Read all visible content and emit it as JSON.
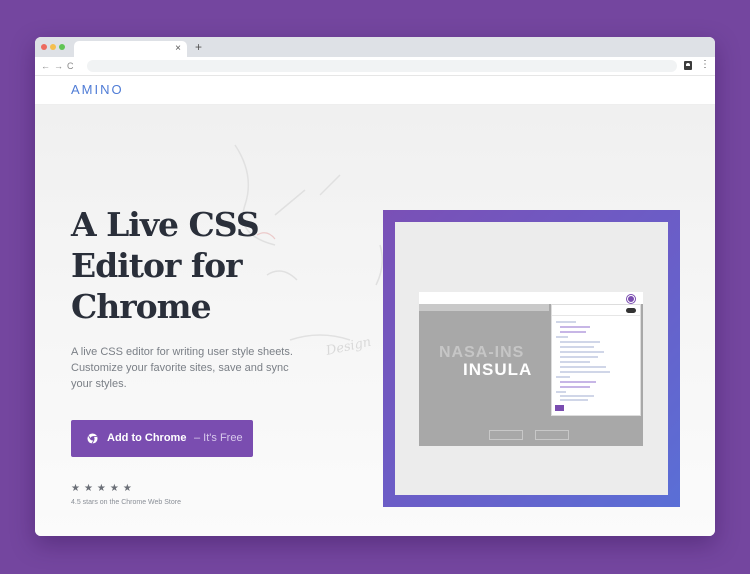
{
  "browser": {
    "tab_close": "×",
    "new_tab": "+",
    "nav": {
      "back": "←",
      "forward": "→",
      "reload": "C"
    },
    "menu": "⋮",
    "icons": [
      "close-icon",
      "plus-icon",
      "back-arrow-icon",
      "forward-arrow-icon",
      "reload-icon",
      "extension-icon",
      "kebab-menu-icon"
    ]
  },
  "site": {
    "logo": "AMINO"
  },
  "hero": {
    "title": "A Live CSS Editor for Chrome",
    "subtitle": "A live CSS editor for writing user style sheets. Customize your favorite sites, save and sync your styles.",
    "cta_label": "Add to Chrome",
    "cta_suffix": "– It's Free",
    "stars": "★★★★★",
    "rating_text": "4.5 stars on the Chrome Web Store"
  },
  "preview": {
    "headline_outline": "NASA-INS",
    "headline": "INSULA"
  },
  "colors": {
    "background": "#74469f",
    "accent": "#7a4db0",
    "logo": "#4f7cd6",
    "title": "#2a2f3a"
  }
}
